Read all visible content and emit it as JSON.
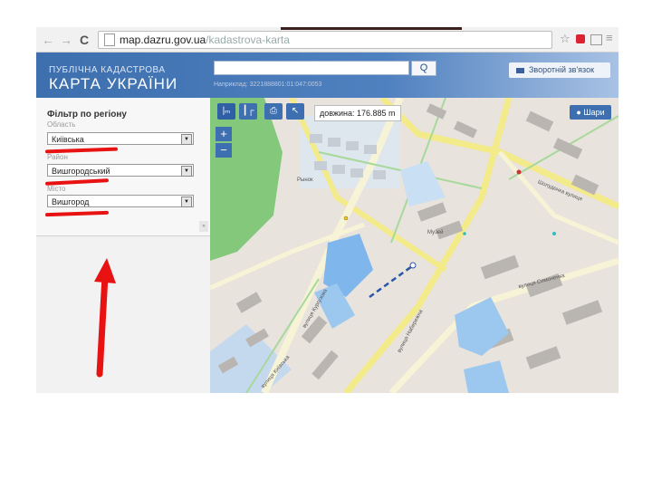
{
  "browser": {
    "url_host": "map.dazru.gov.ua",
    "url_path": "/kadastrova-karta",
    "back_glyph": "←",
    "forward_glyph": "→",
    "reload_glyph": "C",
    "star_glyph": "☆"
  },
  "site": {
    "brand_top": "ПУБЛІЧНА КАДАСТРОВА",
    "brand_main": "КАРТА УКРАЇНИ",
    "search_placeholder": "",
    "search_hint": "Наприклад: 3221888801:01:047:0053",
    "search_button_glyph": "Q",
    "feedback_label": "Зворотній зв'язок"
  },
  "filter_panel": {
    "title": "Фільтр по регіону",
    "fields": [
      {
        "label": "Область",
        "value": "Київська"
      },
      {
        "label": "Район",
        "value": "Вишгородський"
      },
      {
        "label": "Місто",
        "value": "Вишгород"
      }
    ],
    "collapse_glyph": "«"
  },
  "map": {
    "tools": [
      {
        "name": "ruler",
        "glyph": "|ₘ"
      },
      {
        "name": "area",
        "glyph": "┃┌"
      },
      {
        "name": "print",
        "glyph": "⎙"
      },
      {
        "name": "pointer",
        "glyph": "↖"
      }
    ],
    "measure_text": "довжина: 176.885 m",
    "zoom_in": "+",
    "zoom_out": "−",
    "layers_label": "Шари",
    "labels": {
      "market": "Рынок",
      "museum": "Музей",
      "street_1": "вулиця Кургузова",
      "street_2": "Шолуденка вулиця",
      "street_3": "вулиця Набережна",
      "street_4": "вулиця Симоненка",
      "street_5": "вулиця Київська"
    }
  },
  "colors": {
    "header_blue": "#3d6fae",
    "tool_blue": "#3e6fb0",
    "highlight_red": "#e81212",
    "parcel_blue": "#7fb6ec",
    "map_green": "#84c97b",
    "road_yellow": "#f3ea8a"
  }
}
